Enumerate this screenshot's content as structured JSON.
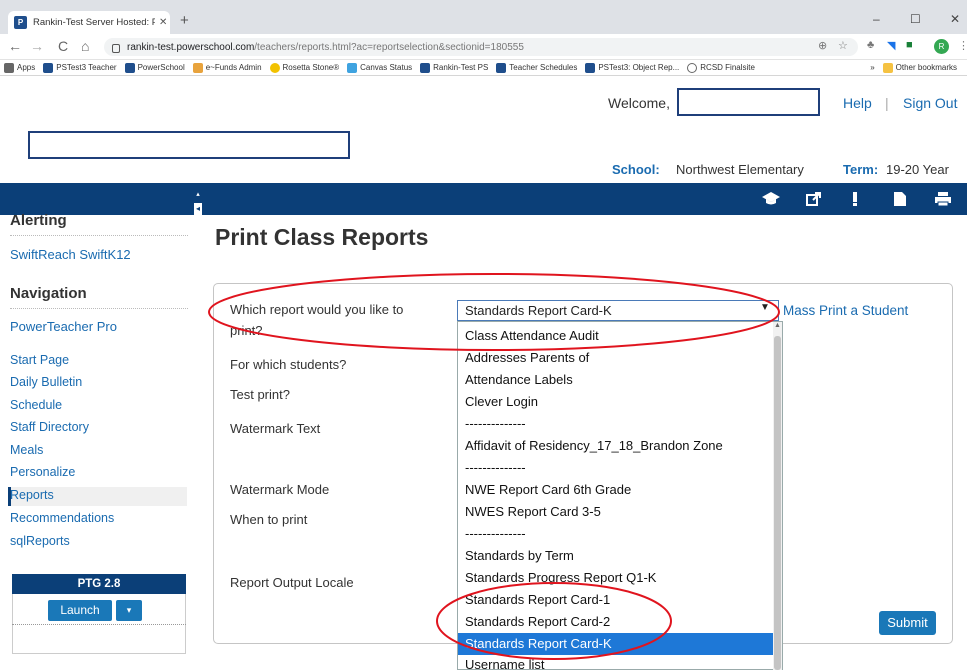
{
  "browser": {
    "tab_title": "Rankin-Test Server Hosted: Print",
    "tab_close": "✕",
    "new_tab": "+",
    "window_controls": [
      "–",
      "☐",
      "✕"
    ],
    "nav": [
      "←",
      "→",
      "C",
      "⌂"
    ],
    "url_host": "rankin-test.powerschool.com",
    "url_path": "/teachers/reports.html?ac=reportselection&sectionid=180555",
    "avatar_letter": "R",
    "bookmarks": [
      {
        "label": "Apps",
        "icon": "apps-icon"
      },
      {
        "label": "PSTest3 Teacher",
        "icon": "powerschool-icon"
      },
      {
        "label": "PowerSchool",
        "icon": "powerschool-icon"
      },
      {
        "label": "e~Funds Admin",
        "icon": "efunds-icon"
      },
      {
        "label": "Rosetta Stone®",
        "icon": "rosetta-icon"
      },
      {
        "label": "Canvas Status",
        "icon": "canvas-icon"
      },
      {
        "label": "Rankin-Test PS",
        "icon": "powerschool-icon"
      },
      {
        "label": "Teacher Schedules",
        "icon": "powerschool-icon"
      },
      {
        "label": "PSTest3: Object Rep...",
        "icon": "powerschool-icon"
      },
      {
        "label": "RCSD Finalsite",
        "icon": "globe-icon"
      }
    ],
    "bookmarks_more": "»",
    "other_bookmarks": "Other bookmarks"
  },
  "header": {
    "welcome": "Welcome,",
    "help": "Help",
    "separator": "|",
    "sign_out": "Sign Out",
    "school_label": "School:",
    "school_value": "Northwest Elementary",
    "term_label": "Term:",
    "term_value": "19-20 Year"
  },
  "sidebar": {
    "alerting_heading": "Alerting",
    "alerting_link": "SwiftReach SwiftK12",
    "navigation_heading": "Navigation",
    "powerteacher_link": "PowerTeacher Pro",
    "items": [
      "Start Page",
      "Daily Bulletin",
      "Schedule",
      "Staff Directory",
      "Meals",
      "Personalize",
      "Reports",
      "Recommendations",
      "sqlReports"
    ],
    "selected_item": "Reports",
    "ptg_title": "PTG 2.8",
    "launch": "Launch",
    "launch_dropdown": "▾"
  },
  "main": {
    "title": "Print Class Reports",
    "labels": {
      "which_report_1": "Which report would you like to",
      "which_report_2": "print?",
      "which_students": "For which students?",
      "test_print": "Test print?",
      "watermark_text": "Watermark Text",
      "watermark_mode": "Watermark Mode",
      "when_to_print": "When to print",
      "output_locale": "Report Output Locale"
    },
    "report_select_value": "Standards Report Card-K",
    "mass_print_link": "Mass Print a Student",
    "submit": "Submit",
    "dropdown_options": [
      "Class Attendance Audit",
      "Addresses Parents of",
      "Attendance Labels",
      "Clever Login",
      "--------------",
      "Affidavit of Residency_17_18_Brandon Zone",
      "--------------",
      "NWE Report Card 6th Grade",
      "NWES Report Card 3-5",
      "--------------",
      "Standards by Term",
      "Standards Progress Report Q1-K",
      "Standards Report Card-1",
      "Standards Report Card-2",
      "Standards Report Card-K",
      "Username list"
    ],
    "selected_option": "Standards Report Card-K"
  },
  "colors": {
    "nav_blue": "#0b3f78",
    "link_blue": "#1a6bb0",
    "highlight": "#1e78d7",
    "annotation_red": "#e0141e"
  }
}
